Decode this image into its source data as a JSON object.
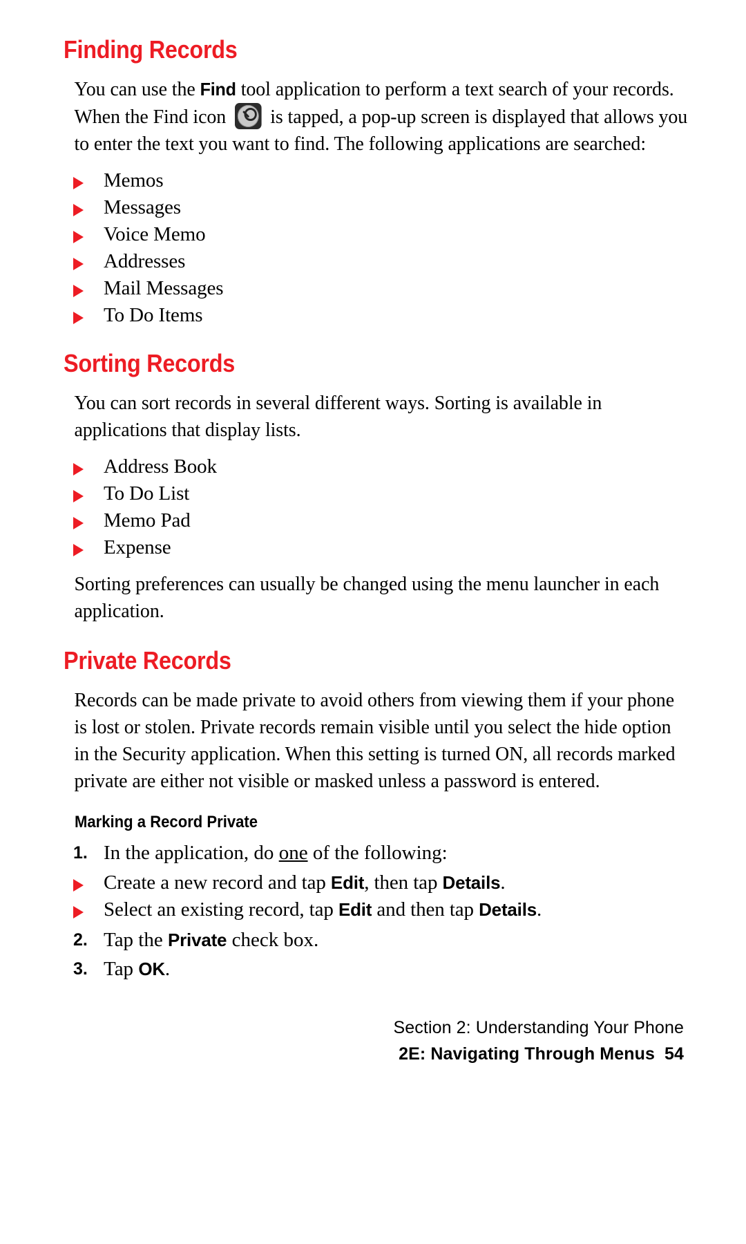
{
  "colors": {
    "heading_red": "#ed1c24",
    "bullet_red": "#ed1c24",
    "text_black": "#000000",
    "page_background": "#ffffff",
    "icon_background": "#2b2b2b",
    "icon_disc": "#c9c9c9"
  },
  "sections": {
    "finding": {
      "heading": "Finding Records",
      "intro": {
        "part1": "You can use the ",
        "term1": "Find",
        "part2": " tool application to perform a text search of your records. When the Find icon ",
        "icon_name": "find-icon",
        "part3": " is tapped, a pop-up screen is displayed that allows you to enter the text you want to find. The following applications are searched:"
      },
      "bullets": [
        "Memos",
        "Messages",
        "Voice Memo",
        "Addresses",
        "Mail Messages",
        "To Do Items"
      ]
    },
    "sorting": {
      "heading": "Sorting Records",
      "intro": "You can sort records in several different ways. Sorting is available in applications that display lists.",
      "bullets": [
        "Address Book",
        "To Do List",
        "Memo Pad",
        "Expense"
      ],
      "outro": "Sorting preferences can usually be changed using the menu launcher in each application."
    },
    "private": {
      "heading": "Private Records",
      "intro": "Records can be made private to avoid others from viewing them if your phone is lost or stolen. Private records remain visible until you select the hide option in the Security application. When this setting is turned ON, all records marked private are either not visible or masked unless a password is entered.",
      "subheading": "Marking a Record Private",
      "steps": [
        {
          "number": "1.",
          "pre": "In the application, do ",
          "underlined": "one",
          "post": " of the following:"
        },
        {
          "number": "2.",
          "pre": "Tap the ",
          "term": "Private",
          "post": " check box."
        },
        {
          "number": "3.",
          "pre": "Tap ",
          "term": "OK",
          "post": "."
        }
      ],
      "sub_bullets": [
        {
          "part1": "Create a new record and tap ",
          "term1": "Edit",
          "part2": ", then tap ",
          "term2": "Details",
          "part3": "."
        },
        {
          "part1": "Select an existing record, tap ",
          "term1": "Edit",
          "part2": " and then tap ",
          "term2": "Details",
          "part3": "."
        }
      ]
    }
  },
  "footer": {
    "line1": "Section 2: Understanding Your Phone",
    "line2": "2E: Navigating Through Menus",
    "page_number": "54"
  }
}
